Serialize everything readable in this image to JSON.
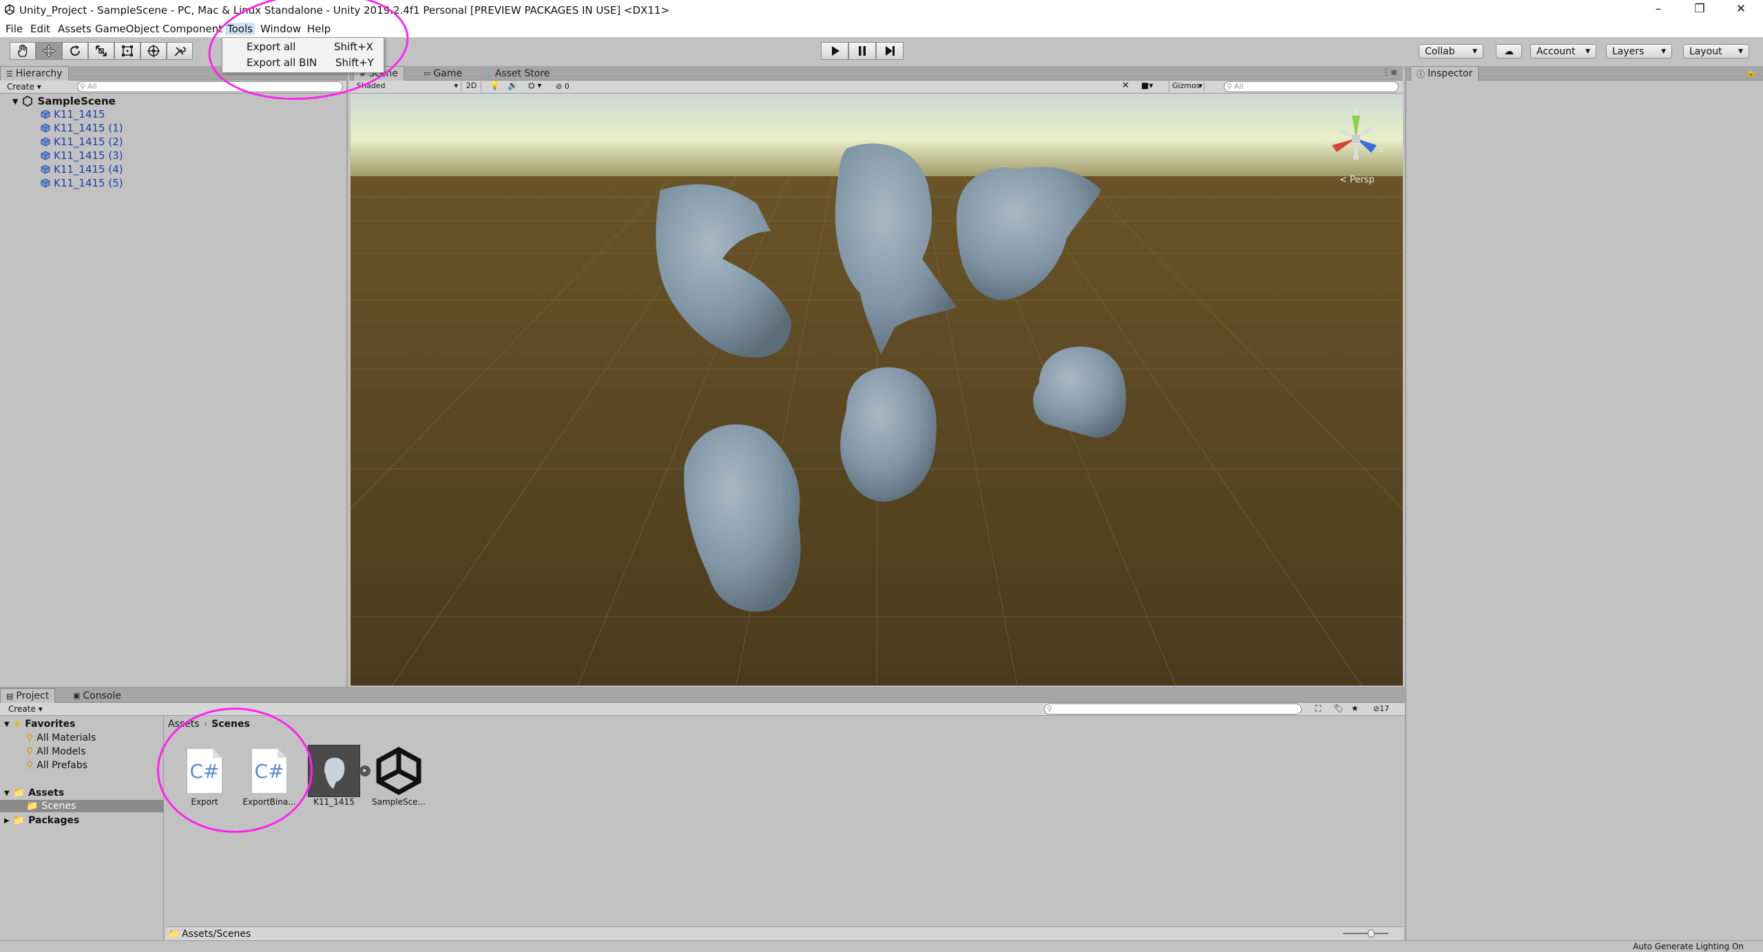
{
  "window": {
    "title": "Unity_Project - SampleScene - PC, Mac & Linux Standalone - Unity 2019.2.4f1 Personal [PREVIEW PACKAGES IN USE] <DX11>",
    "controls": [
      "–",
      "❐",
      "✕"
    ]
  },
  "menubar": {
    "items": [
      "File",
      "Edit",
      "Assets",
      "GameObject",
      "Component",
      "Tools",
      "Window",
      "Help"
    ],
    "active": "Tools"
  },
  "tools_menu": {
    "items": [
      {
        "label": "Export all",
        "shortcut": "Shift+X"
      },
      {
        "label": "Export all BIN",
        "shortcut": "Shift+Y"
      }
    ]
  },
  "toolbar": {
    "tools": [
      "hand-tool",
      "move-tool",
      "rotate-tool",
      "scale-tool",
      "rect-tool",
      "transform-tool",
      "custom-tool"
    ],
    "play_controls": [
      "play",
      "pause",
      "step"
    ],
    "collab": "Collab",
    "account": "Account",
    "layers": "Layers",
    "layout": "Layout"
  },
  "hierarchy": {
    "tab": "Hierarchy",
    "create": "Create",
    "search_placeholder": "All",
    "scene": "SampleScene",
    "items": [
      "K11_1415",
      "K11_1415 (1)",
      "K11_1415 (2)",
      "K11_1415 (3)",
      "K11_1415 (4)",
      "K11_1415 (5)"
    ]
  },
  "scene_view": {
    "tabs": [
      "Scene",
      "Game",
      "Asset Store"
    ],
    "shading": "Shaded",
    "mode_2d": "2D",
    "hidden_count": "0",
    "gizmos": "Gizmos",
    "search_placeholder": "All",
    "persp": "Persp",
    "axes": {
      "y": "y",
      "x": "x",
      "z": "z"
    }
  },
  "inspector": {
    "tab": "Inspector"
  },
  "project": {
    "tabs": [
      "Project",
      "Console"
    ],
    "create": "Create",
    "favorites_label": "Favorites",
    "favorites": [
      "All Materials",
      "All Models",
      "All Prefabs"
    ],
    "assets_label": "Assets",
    "assets_children": [
      "Scenes"
    ],
    "packages_label": "Packages",
    "breadcrumb": [
      "Assets",
      "Scenes"
    ],
    "assets": [
      {
        "name": "Export",
        "type": "csharp",
        "icon_text": "C#"
      },
      {
        "name": "ExportBina...",
        "type": "csharp",
        "icon_text": "C#"
      },
      {
        "name": "K11_1415",
        "type": "model"
      },
      {
        "name": "SampleSce...",
        "type": "unity-scene"
      }
    ],
    "hidden_count": "17",
    "path": "Assets/Scenes"
  },
  "status": {
    "text": "Auto Generate Lighting On"
  },
  "colors": {
    "annotation": "#ff22ee",
    "hierarchy_link": "#1a3da8",
    "ground": "#5a4522",
    "sky": "#e8efc8"
  }
}
